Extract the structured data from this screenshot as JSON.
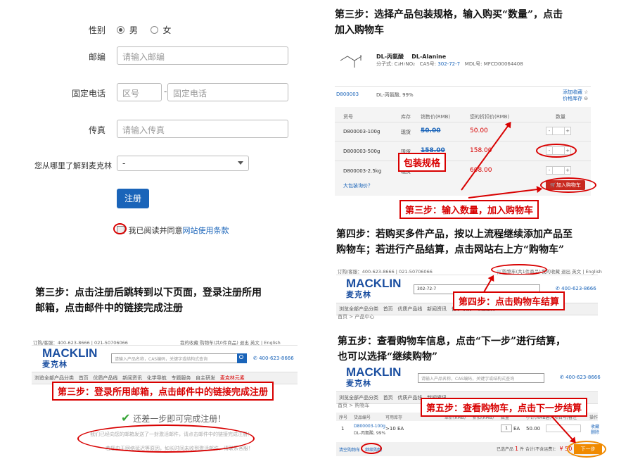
{
  "form": {
    "gender_label": "性别",
    "gender_male": "男",
    "gender_female": "女",
    "postcode_label": "邮编",
    "postcode_placeholder": "请输入邮编",
    "phone_label": "固定电话",
    "area_placeholder": "区号",
    "phone_placeholder": "固定电话",
    "fax_label": "传真",
    "fax_placeholder": "请输入传真",
    "source_label": "您从哪里了解到麦克林",
    "source_value": "-",
    "register_button": "注册",
    "agree_text": "我已阅读并同意",
    "agree_link": "网站使用条款"
  },
  "step3_register": {
    "title_line1": "第三步：点击注册后跳转到以下页面，登录注册所用",
    "title_line2": "邮箱，点击邮件中的链接完成注册",
    "topbar_left": "订购/客服：400-623-8666 | 021-50706066",
    "topbar_right": "我的收藏   购物车(共0件商品)   退出   英文 | English",
    "logo": "MACKLIN",
    "logo_cn": "麦克林",
    "search_placeholder": "请输入产品名称，CAS编码，关键字或结构式查询",
    "hotline": "400-623-8666",
    "nav": [
      "浏览全部产品分类",
      "首页",
      "优质产品线",
      "新闻资讯",
      "化学导航",
      "专题服务",
      "自主研发",
      "麦克林元素"
    ],
    "callout": "第三步：登录所用邮箱，点击邮件中的链接完成注册",
    "check_icon": "check-icon",
    "success_text": "还差一步即可完成注册！",
    "notice1": "我们已经向您的邮箱发送了一封激活邮件，请点击邮件中的链接完成注册！",
    "notice2": "若您由于网络延迟等原因，如长时间未收到激活邮件，请联系客服！"
  },
  "step3_cart": {
    "title_line1": "第三步：选择产品包装规格，输入购买“数量”，点击",
    "title_line2": "加入购物车",
    "product_name_cn": "DL-丙氨酸",
    "product_name_en": "DL-Alanine",
    "formula": "分子式: C₃H₇NO₂",
    "cas_label": "CAS号:",
    "cas_value": "302-72-7",
    "mdl": "MDL号: MFCD00064408",
    "product_code": "D800003",
    "product_desc": "DL-丙氨酸, 99%",
    "favorite": "添加收藏",
    "stock_link": "价格库存",
    "headers": [
      "货号",
      "库存",
      "销售价(RMB)",
      "您的折扣价(RMB)",
      "数量"
    ],
    "rows": [
      {
        "code": "D800003-100g",
        "stock": "现货",
        "price": "50.00",
        "discount": "50.00"
      },
      {
        "code": "D800003-500g",
        "stock": "现货",
        "price": "158.00",
        "discount": "158.00"
      },
      {
        "code": "D800003-2.5kg",
        "stock": "现货",
        "price": "608.00",
        "discount": "608.00"
      }
    ],
    "bulk_link": "大包装询价？",
    "add_cart_button": "加入购物车",
    "callout_spec": "包装规格",
    "callout_qty": "第三步：输入数量，加入购物车"
  },
  "step4": {
    "title_line1": "第四步：若购买多件产品，按以上流程继续添加产品至",
    "title_line2": "购物车；若进行产品结算，点击网站右上方“购物车”",
    "topbar_left": "订购/客服：400-623-8666 | 021-50706066",
    "topbar_cart": "购物车(共1件商品)",
    "topbar_right": "我的收藏   退出   英文 | English",
    "search_value": "302-72-7",
    "hotline": "400-623-8666",
    "nav": [
      "浏览全部产品分类",
      "首页",
      "优质产品线",
      "新闻资讯",
      "化学导航",
      "专题服务"
    ],
    "breadcrumb": "首页 > 产品中心",
    "callout": "第四步：点击购物车结算"
  },
  "step5": {
    "title_line1": "第五步：查看购物车信息，点击“下一步”进行结算，",
    "title_line2": "也可以选择“继续购物”",
    "search_placeholder": "请输入产品名称，CAS编码，关键字或结构式查询",
    "hotline": "400-623-8666",
    "nav": [
      "浏览全部产品分类",
      "首页",
      "优质产品线",
      "新闻资讯"
    ],
    "breadcrumb": "首页 > 购物车",
    "headers": [
      "序号",
      "货品编号",
      "可用库存",
      "单价(RMB)",
      "折扣(RMB)",
      "数量",
      "",
      "小计(RMB)",
      "客户项目号/备注",
      "操作"
    ],
    "row": {
      "index": "1",
      "code": "D800003-100g",
      "desc": "DL-丙氨酸, 99%",
      "stock": ">10 EA",
      "qty": "1",
      "unit": "EA",
      "subtotal": "50.00",
      "ops1": "收藏",
      "ops2": "删除"
    },
    "clear_link": "清空购物车",
    "continue_link": "继续购物",
    "summary_pre": "已选产品",
    "summary_count": "1",
    "summary_mid": "件  合计(不含运费)：",
    "summary_total": "¥ 50",
    "next_button": "下一步",
    "callout": "第五步：查看购物车，点击下一步结算"
  }
}
